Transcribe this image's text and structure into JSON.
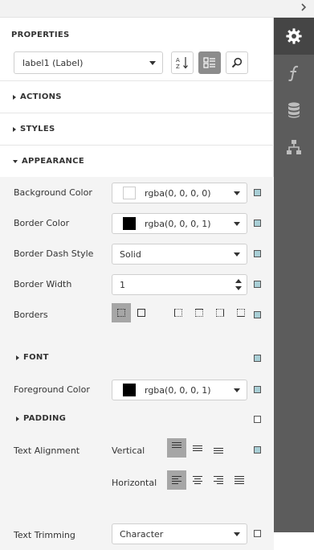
{
  "panel": {
    "title": "PROPERTIES",
    "component_select": "label1 (Label)"
  },
  "sections": {
    "actions": "ACTIONS",
    "styles": "STYLES",
    "appearance": "APPEARANCE"
  },
  "appearance": {
    "background_color": {
      "label": "Background Color",
      "value": "rgba(0, 0, 0, 0)",
      "swatch": "#ffffff"
    },
    "border_color": {
      "label": "Border Color",
      "value": "rgba(0, 0, 0, 1)",
      "swatch": "#000000"
    },
    "border_dash_style": {
      "label": "Border Dash Style",
      "value": "Solid"
    },
    "border_width": {
      "label": "Border Width",
      "value": "1"
    },
    "borders": {
      "label": "Borders"
    },
    "font": {
      "label": "FONT"
    },
    "foreground_color": {
      "label": "Foreground Color",
      "value": "rgba(0, 0, 0, 1)",
      "swatch": "#000000"
    },
    "padding": {
      "label": "PADDING"
    },
    "text_alignment": {
      "label": "Text Alignment",
      "vertical_label": "Vertical",
      "horizontal_label": "Horizontal"
    },
    "text_trimming": {
      "label": "Text Trimming",
      "value": "Character"
    }
  },
  "colors": {
    "rail": "#5c5c5c",
    "rail_active": "#454545",
    "indicator_set": "#a9cfd6",
    "button_active": "#a6a6a6"
  },
  "icons": [
    "chevron-right-icon",
    "gear-icon",
    "function-icon",
    "database-icon",
    "hierarchy-icon",
    "sort-az-icon",
    "categorized-icon",
    "search-icon"
  ]
}
